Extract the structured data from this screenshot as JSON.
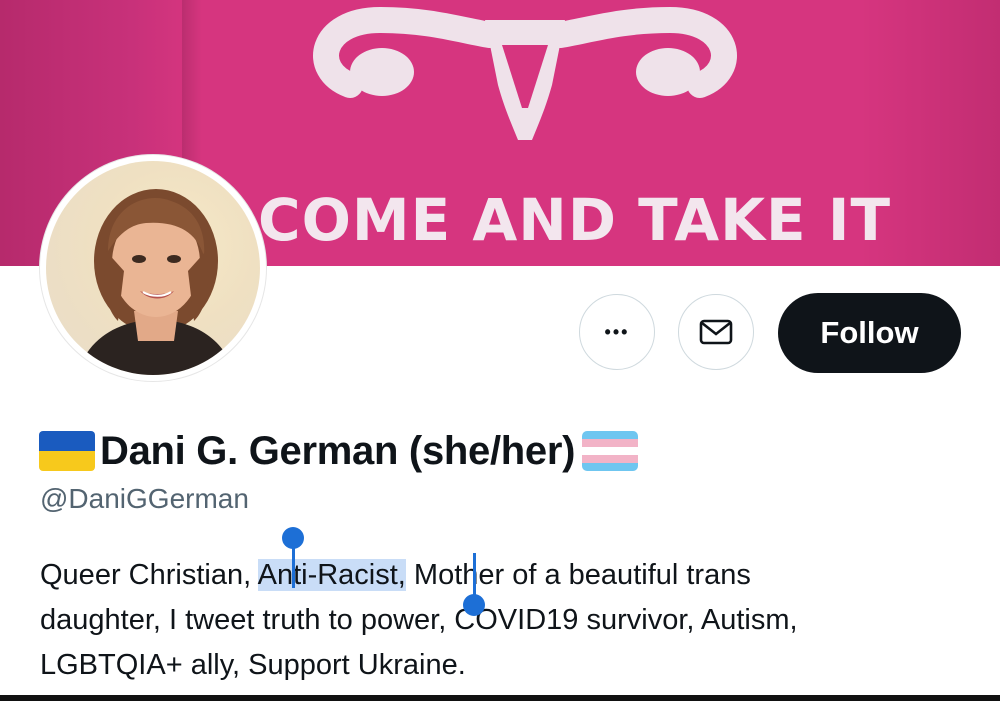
{
  "banner": {
    "text": "COME AND TAKE IT",
    "color": "#d6357f",
    "graphic_icon": "uterus-icon"
  },
  "profile": {
    "avatar_icon": "avatar-portrait",
    "name": "Dani G. German (she/her)",
    "name_prefix_emoji": "ukraine-flag-emoji",
    "name_suffix_emoji": "transgender-flag-emoji",
    "handle": "@DaniGGerman"
  },
  "actions": {
    "more_icon": "ellipsis-icon",
    "more_label": "•••",
    "message_icon": "envelope-icon",
    "follow_label": "Follow"
  },
  "bio": {
    "line1_before": "Queer Christian, ",
    "line1_selected": "Anti-Racist,",
    "line1_after": " Mother of a beautiful trans",
    "line2": "daughter, I tweet truth to power, COVID19 survivor,  Autism,",
    "line3": "LGBTQIA+ ally, Support Ukraine.",
    "selection_color": "#c9ddf7",
    "cursor_color": "#1d6fd6"
  }
}
